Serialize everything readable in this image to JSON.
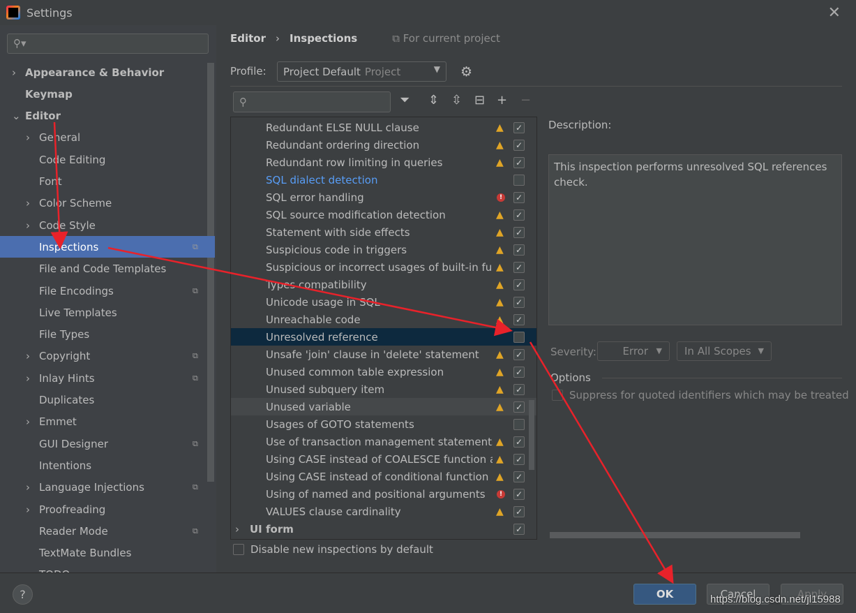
{
  "window": {
    "title": "Settings",
    "close_icon": "close-icon"
  },
  "sidebar": {
    "search_placeholder": "",
    "items": [
      {
        "label": "Appearance & Behavior",
        "arrow": "›",
        "level": 0,
        "bold": true
      },
      {
        "label": "Keymap",
        "level": 0,
        "bold": true
      },
      {
        "label": "Editor",
        "arrow": "⌄",
        "level": 0,
        "bold": true
      },
      {
        "label": "General",
        "arrow": "›",
        "level": 1
      },
      {
        "label": "Code Editing",
        "level": 1
      },
      {
        "label": "Font",
        "level": 1
      },
      {
        "label": "Color Scheme",
        "arrow": "›",
        "level": 1
      },
      {
        "label": "Code Style",
        "arrow": "›",
        "level": 1
      },
      {
        "label": "Inspections",
        "level": 1,
        "selected": true,
        "copy": true
      },
      {
        "label": "File and Code Templates",
        "level": 1
      },
      {
        "label": "File Encodings",
        "level": 1,
        "copy": true
      },
      {
        "label": "Live Templates",
        "level": 1
      },
      {
        "label": "File Types",
        "level": 1
      },
      {
        "label": "Copyright",
        "arrow": "›",
        "level": 1,
        "copy": true
      },
      {
        "label": "Inlay Hints",
        "arrow": "›",
        "level": 1,
        "copy": true
      },
      {
        "label": "Duplicates",
        "level": 1
      },
      {
        "label": "Emmet",
        "arrow": "›",
        "level": 1
      },
      {
        "label": "GUI Designer",
        "level": 1,
        "copy": true
      },
      {
        "label": "Intentions",
        "level": 1
      },
      {
        "label": "Language Injections",
        "arrow": "›",
        "level": 1,
        "copy": true
      },
      {
        "label": "Proofreading",
        "arrow": "›",
        "level": 1
      },
      {
        "label": "Reader Mode",
        "level": 1,
        "copy": true
      },
      {
        "label": "TextMate Bundles",
        "level": 1
      },
      {
        "label": "TODO",
        "level": 1
      }
    ]
  },
  "breadcrumb": {
    "parent": "Editor",
    "sep": "›",
    "current": "Inspections",
    "scope": "For current project"
  },
  "profile": {
    "label": "Profile:",
    "value": "Project Default",
    "sub": "Project"
  },
  "inspections": [
    {
      "name": "Redundant ELSE NULL clause",
      "sev": "warn",
      "checked": true
    },
    {
      "name": "Redundant ordering direction",
      "sev": "warn",
      "checked": true
    },
    {
      "name": "Redundant row limiting in queries",
      "sev": "warn",
      "checked": true
    },
    {
      "name": "SQL dialect detection",
      "sev": "",
      "checked": false,
      "link": true
    },
    {
      "name": "SQL error handling",
      "sev": "error",
      "checked": true
    },
    {
      "name": "SQL source modification detection",
      "sev": "warn",
      "checked": true
    },
    {
      "name": "Statement with side effects",
      "sev": "warn",
      "checked": true
    },
    {
      "name": "Suspicious code in triggers",
      "sev": "warn",
      "checked": true
    },
    {
      "name": "Suspicious or incorrect usages of built-in fun",
      "sev": "warn",
      "checked": true
    },
    {
      "name": "Types compatibility",
      "sev": "warn",
      "checked": true
    },
    {
      "name": "Unicode usage in SQL",
      "sev": "warn",
      "checked": true
    },
    {
      "name": "Unreachable code",
      "sev": "warn",
      "checked": true
    },
    {
      "name": "Unresolved reference",
      "sev": "",
      "checked": false,
      "selected": true
    },
    {
      "name": "Unsafe 'join' clause in 'delete' statement",
      "sev": "warn",
      "checked": true
    },
    {
      "name": "Unused common table expression",
      "sev": "warn",
      "checked": true
    },
    {
      "name": "Unused subquery item",
      "sev": "warn",
      "checked": true
    },
    {
      "name": "Unused variable",
      "sev": "warn",
      "checked": true,
      "hover": true
    },
    {
      "name": "Usages of GOTO statements",
      "sev": "",
      "checked": false
    },
    {
      "name": "Use of transaction management statements i",
      "sev": "warn",
      "checked": true
    },
    {
      "name": "Using CASE instead of COALESCE function an",
      "sev": "warn",
      "checked": true
    },
    {
      "name": "Using CASE instead of conditional function ar",
      "sev": "warn",
      "checked": true
    },
    {
      "name": "Using of named and positional arguments",
      "sev": "error",
      "checked": true
    },
    {
      "name": "VALUES clause cardinality",
      "sev": "warn",
      "checked": true
    },
    {
      "name": "UI form",
      "sev": "",
      "checked": true,
      "group": true
    }
  ],
  "description": {
    "label": "Description:",
    "text": "This inspection performs unresolved SQL references check."
  },
  "severity": {
    "label": "Severity:",
    "value": "Error",
    "scope": "In All Scopes"
  },
  "options": {
    "label": "Options",
    "suppress": "Suppress for quoted identifiers which may be treated"
  },
  "disable_new": "Disable new inspections by default",
  "footer": {
    "help": "?",
    "ok": "OK",
    "cancel": "Cancel",
    "apply": "Apply",
    "watermark": "https://blog.csdn.net/jl15988"
  },
  "colors": {
    "accent": "#4b6eaf",
    "selected_row": "#0d293e",
    "warning": "#e0a526",
    "error": "#c73a36",
    "annotation": "#e8222a"
  }
}
